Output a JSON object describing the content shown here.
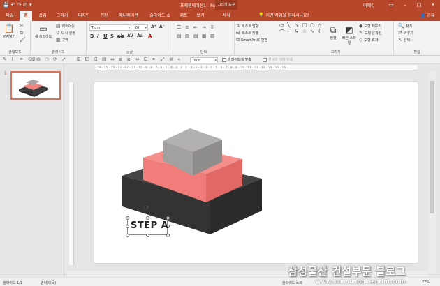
{
  "titlebar": {
    "doc_title": "프레젠테이션1 - PowerPoint",
    "context_title": "그리기 도구",
    "user": "이예강",
    "qat": [
      "💾",
      "↶",
      "↷",
      "⎚",
      "▾"
    ],
    "win": [
      "▭",
      "–",
      "▢",
      "✕"
    ]
  },
  "tabs": [
    "파일",
    "홈",
    "삽입",
    "그리기",
    "디자인",
    "전환",
    "애니메이션",
    "슬라이드 쇼",
    "검토",
    "보기",
    "서식"
  ],
  "tellme": "어떤 작업을 원하시나요?",
  "share": "공유",
  "ribbon": {
    "clipboard": {
      "paste": "붙여넣기",
      "label": "클립보드"
    },
    "slides": {
      "new_slide": "새 슬라이드",
      "layout": "레이아웃",
      "reset": "다시 설정",
      "section": "구역",
      "label": "슬라이드"
    },
    "font": {
      "font_name": "Tium",
      "font_size": "28",
      "label": "글꼴"
    },
    "paragraph": {
      "label": "단락"
    },
    "text": {
      "text_direction": "텍스트 방향",
      "align_text": "텍스트 맞춤",
      "smartart": "SmartArt로 변환"
    },
    "drawing": {
      "arrange": "정렬",
      "quick_styles": "빠른 스타일",
      "fill": "도형 채우기",
      "outline": "도형 윤곽선",
      "effects": "도형 효과",
      "label": "그리기"
    },
    "editing": {
      "find": "찾기",
      "replace": "바꾸기",
      "select": "선택",
      "label": "편집"
    }
  },
  "toolbar2": {
    "font_combo": "Tium",
    "fit_slide": "슬라이드에 맞춤",
    "selected_objects": "선택한 개체 맞춤"
  },
  "ruler_text": "· 16 · 15 · 14 · 13 · 12 · 11 · 10 · 9 · 8 · 7 · 6 · 5 · 4 · 3 · 2 · 1 · 0 · 1 · 2 · 3 · 4 · 5 · 6 · 7 · 8 · 9 · 10 · 11 · 12 · 13 · 14 · 15 · 16 ·",
  "thumb_number": "1",
  "slide": {
    "step_label": "STEP A"
  },
  "colors": {
    "accent": "#b7472a",
    "top_block": "#a7a4a4",
    "mid_block": "#f08481",
    "base_block": "#3d3d3d"
  },
  "statusbar": {
    "slide_info": "슬라이드 1/1",
    "language": "영어(미국)",
    "notes": "슬라이드 노트",
    "zoom": "77%"
  },
  "watermark": {
    "title": "삼성물산 건설부문 블로그",
    "url": "www.samsungblueprint.com"
  }
}
